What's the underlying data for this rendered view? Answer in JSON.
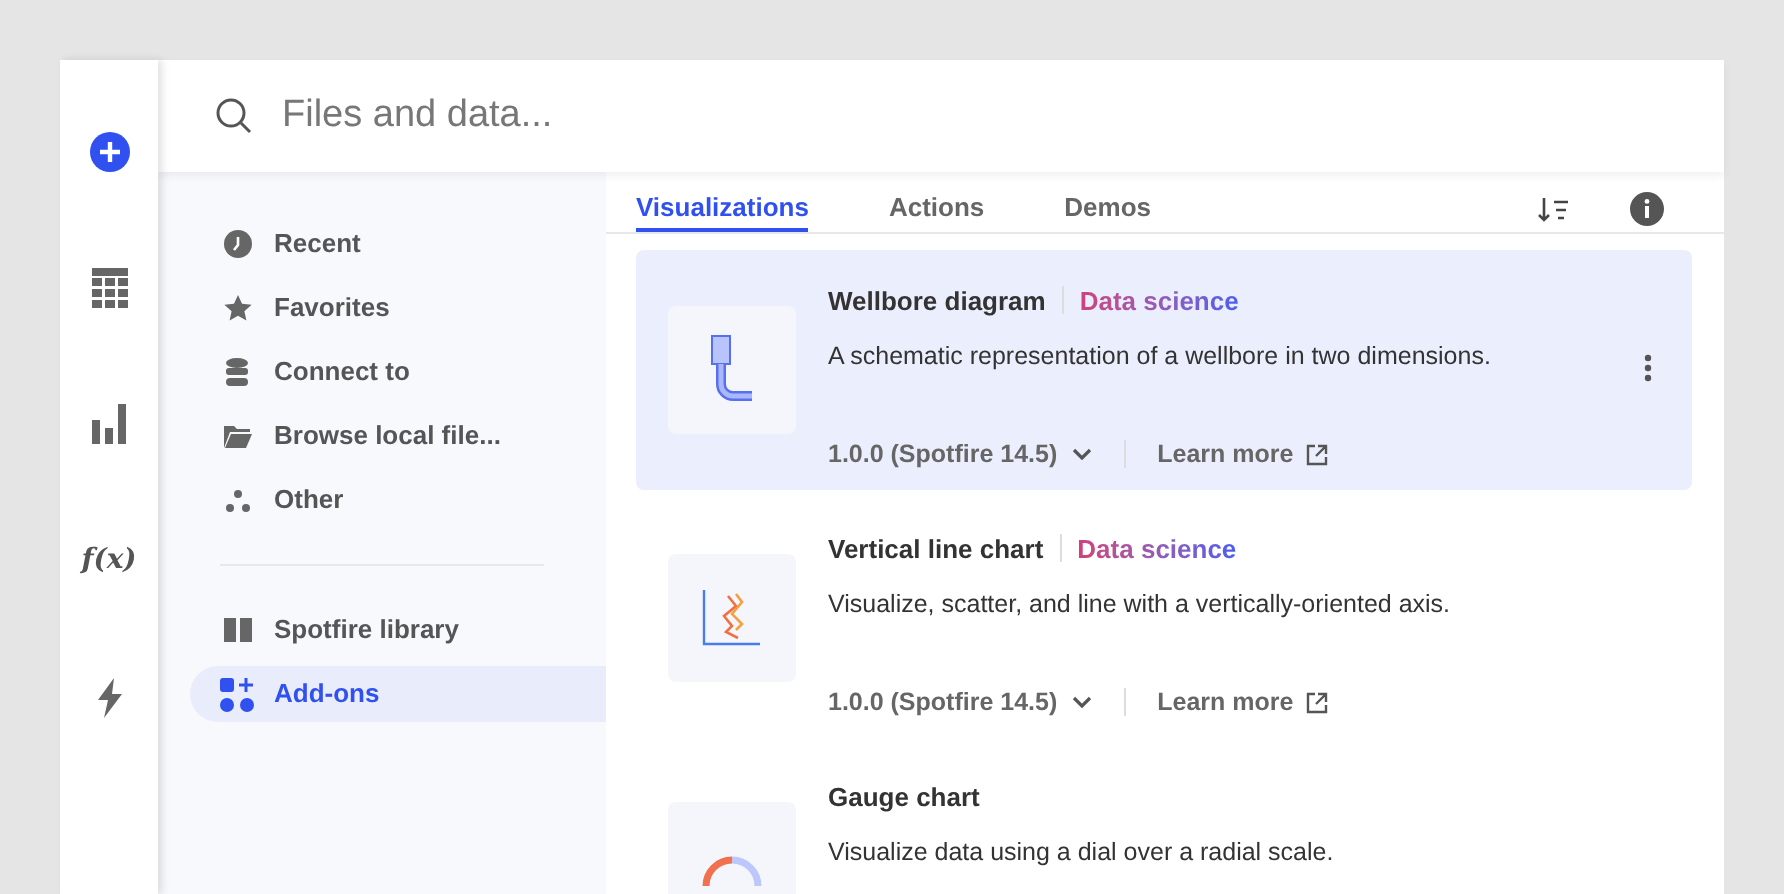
{
  "rail": [
    {
      "kind": "add"
    },
    {
      "kind": "table"
    },
    {
      "kind": "bars"
    },
    {
      "kind": "function",
      "label": "f(x)"
    },
    {
      "kind": "bolt"
    }
  ],
  "search": {
    "placeholder": "Files and data..."
  },
  "sidebar": {
    "groups": [
      {
        "items": [
          {
            "kind": "clock",
            "label": "Recent",
            "selected": false
          },
          {
            "kind": "star",
            "label": "Favorites",
            "selected": false
          },
          {
            "kind": "database",
            "label": "Connect to",
            "selected": false
          },
          {
            "kind": "folder",
            "label": "Browse local file...",
            "selected": false
          },
          {
            "kind": "dots",
            "label": "Other",
            "selected": false
          }
        ]
      },
      {
        "items": [
          {
            "kind": "book",
            "label": "Spotfire library",
            "selected": false
          },
          {
            "kind": "addons",
            "label": "Add-ons",
            "selected": true
          }
        ]
      }
    ]
  },
  "tabs": [
    {
      "label": "Visualizations",
      "selected": true
    },
    {
      "label": "Actions",
      "selected": false
    },
    {
      "label": "Demos",
      "selected": false
    }
  ],
  "cards": [
    {
      "kind": "wellbore",
      "name": "Wellbore diagram",
      "tag": "Data science",
      "description": "A schematic representation of a wellbore in two dimensions.",
      "version": "1.0.0 (Spotfire 14.5)",
      "link": "Learn more",
      "selected": true
    },
    {
      "kind": "vline",
      "name": "Vertical line chart",
      "tag": "Data science",
      "description": "Visualize, scatter, and line with a vertically-oriented axis.",
      "version": "1.0.0 (Spotfire 14.5)",
      "link": "Learn more",
      "selected": false
    },
    {
      "kind": "gauge",
      "name": "Gauge chart",
      "description": "Visualize data using a dial over a radial scale.",
      "selected": false
    }
  ]
}
